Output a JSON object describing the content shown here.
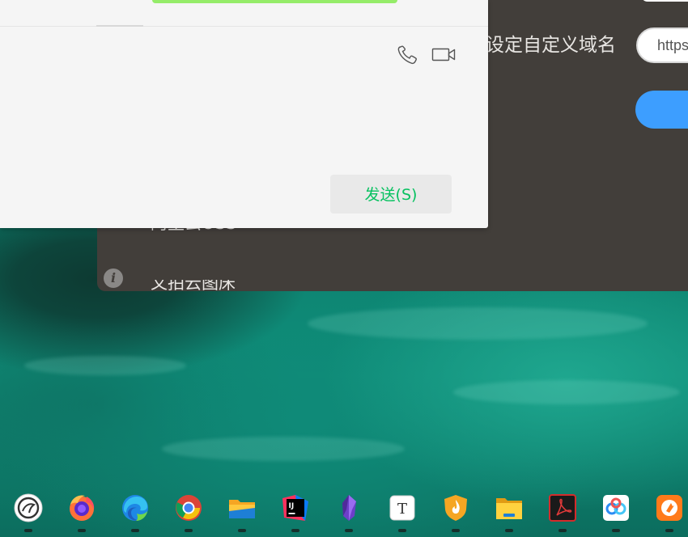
{
  "back_window": {
    "heading": "设定自定义域名",
    "url_value": "https:",
    "cut_text_1": "阿里云OSS",
    "cut_text_2": "又拍云图床"
  },
  "chat_window": {
    "send_label": "发送(S)",
    "icons": [
      "phone-icon",
      "video-call-icon"
    ]
  },
  "dock": {
    "items": [
      "app-icon",
      "firefox-icon",
      "edge-icon",
      "chrome-icon",
      "file-manager-icon",
      "intellij-idea-icon",
      "obsidian-icon",
      "typora-icon",
      "security-app-icon",
      "folder-icon",
      "pdf-reader-icon",
      "baidu-netdisk-icon",
      "orange-app-icon"
    ]
  },
  "colors": {
    "send_text": "#07c160",
    "accent_blue": "#3d9eff",
    "dark_panel": "#423e3a",
    "chat_bg": "#f5f5f5"
  }
}
